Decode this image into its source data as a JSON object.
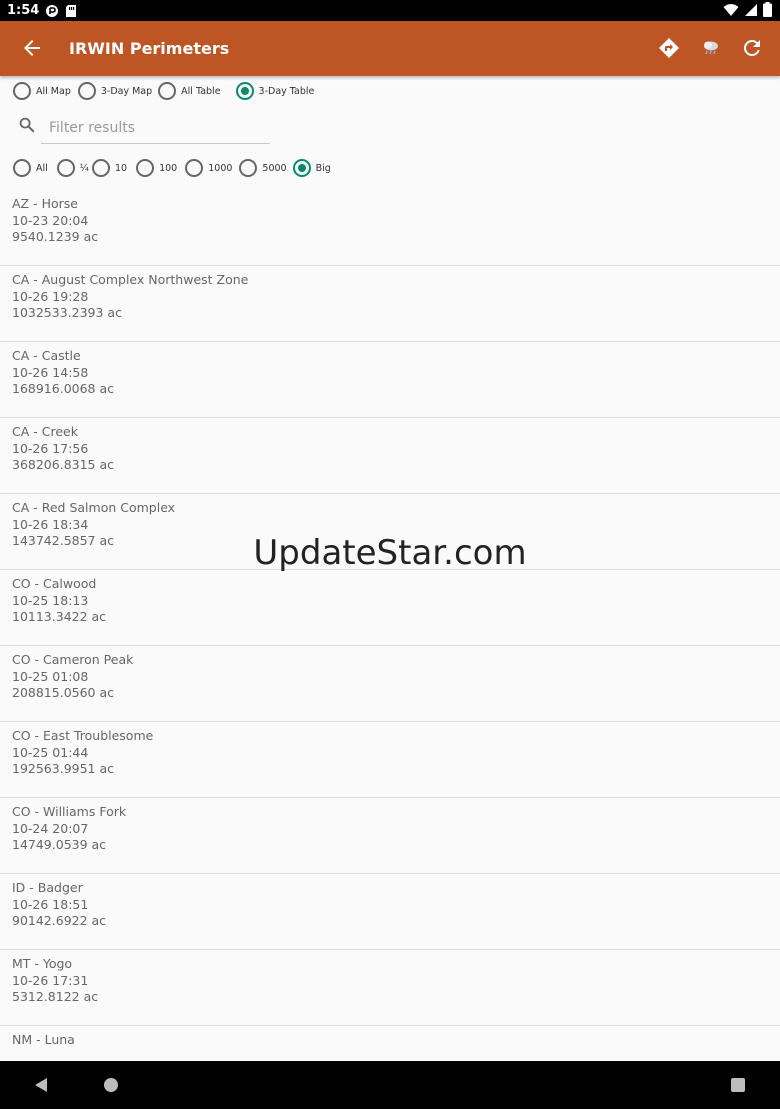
{
  "status_bar": {
    "time": "1:54"
  },
  "app_bar": {
    "title": "IRWIN Perimeters",
    "back_icon": "arrow-left-icon",
    "actions": [
      "directions-icon",
      "weather-icon",
      "refresh-icon"
    ]
  },
  "view_options": [
    {
      "label": "All Map",
      "checked": false
    },
    {
      "label": "3-Day Map",
      "checked": false
    },
    {
      "label": "All Table",
      "checked": false
    },
    {
      "label": "3-Day Table",
      "checked": true
    }
  ],
  "search": {
    "placeholder": "Filter results",
    "value": ""
  },
  "size_options": [
    {
      "label": "All",
      "checked": false
    },
    {
      "label": "¼",
      "checked": false
    },
    {
      "label": "10",
      "checked": false
    },
    {
      "label": "100",
      "checked": false
    },
    {
      "label": "1000",
      "checked": false
    },
    {
      "label": "5000",
      "checked": false
    },
    {
      "label": "Big",
      "checked": true
    }
  ],
  "fires": [
    {
      "name": "AZ - Horse",
      "time": "10-23 20:04",
      "acres": "9540.1239 ac"
    },
    {
      "name": "CA - August Complex Northwest Zone",
      "time": "10-26 19:28",
      "acres": "1032533.2393 ac"
    },
    {
      "name": "CA - Castle",
      "time": "10-26 14:58",
      "acres": "168916.0068 ac"
    },
    {
      "name": "CA - Creek",
      "time": "10-26 17:56",
      "acres": "368206.8315 ac"
    },
    {
      "name": "CA - Red Salmon Complex",
      "time": "10-26 18:34",
      "acres": "143742.5857 ac"
    },
    {
      "name": "CO - Calwood",
      "time": "10-25 18:13",
      "acres": "10113.3422 ac"
    },
    {
      "name": "CO - Cameron Peak",
      "time": "10-25 01:08",
      "acres": "208815.0560 ac"
    },
    {
      "name": "CO - East Troublesome",
      "time": "10-25 01:44",
      "acres": "192563.9951 ac"
    },
    {
      "name": "CO - Williams Fork",
      "time": "10-24 20:07",
      "acres": "14749.0539 ac"
    },
    {
      "name": "ID - Badger",
      "time": "10-26 18:51",
      "acres": "90142.6922 ac"
    },
    {
      "name": "MT - Yogo",
      "time": "10-26 17:31",
      "acres": "5312.8122 ac"
    },
    {
      "name": "NM - Luna",
      "time": "",
      "acres": ""
    }
  ],
  "watermark": "UpdateStar.com",
  "colors": {
    "app_bar": "#bd5525",
    "accent": "#0a8a6a"
  }
}
